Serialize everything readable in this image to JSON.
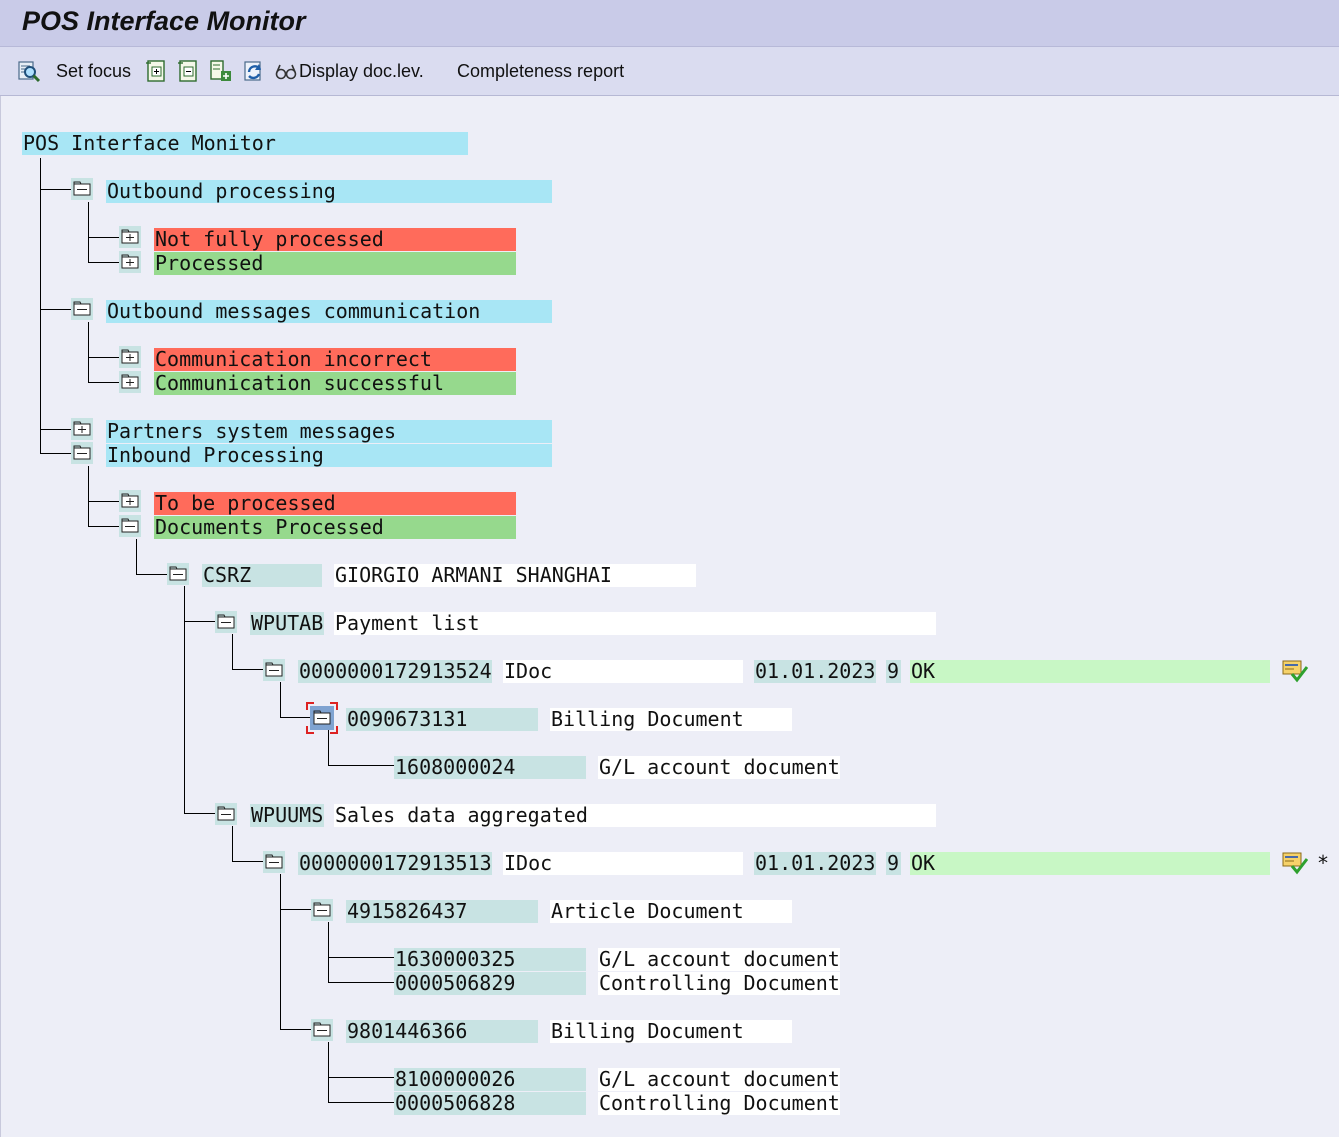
{
  "window": {
    "title": "POS Interface Monitor"
  },
  "toolbar": {
    "set_focus": "Set focus",
    "display_doc_level": "Display doc.lev.",
    "completeness_report": "Completeness report"
  },
  "tree": {
    "root": "POS Interface Monitor",
    "outbound_processing": "Outbound processing",
    "not_fully_processed": "Not fully processed",
    "processed": "Processed",
    "outbound_messages_communication": "Outbound messages communication",
    "communication_incorrect": "Communication incorrect",
    "communication_successful": "Communication successful",
    "partners_system_messages": "Partners system messages",
    "inbound_processing": "Inbound Processing",
    "to_be_processed": "To be processed",
    "documents_processed": "Documents Processed",
    "store": {
      "code": "CSRZ",
      "name": "GIORGIO ARMANI SHANGHAI"
    },
    "wputab": {
      "code": "WPUTAB",
      "desc": "Payment list",
      "idoc": {
        "number": "0000000172913524",
        "type": "IDoc",
        "date": "01.01.2023",
        "status": "9",
        "text": "OK"
      },
      "billing": {
        "number": "0090673131",
        "desc": "Billing Document"
      },
      "gl": {
        "number": "1608000024",
        "desc": "G/L account document"
      }
    },
    "wpuums": {
      "code": "WPUUMS",
      "desc": "Sales data aggregated",
      "idoc": {
        "number": "0000000172913513",
        "type": "IDoc",
        "date": "01.01.2023",
        "status": "9",
        "text": "OK",
        "mark": "*"
      },
      "article": {
        "number": "4915826437",
        "desc": "Article Document"
      },
      "gl1": {
        "number": "1630000325",
        "desc": "G/L account document"
      },
      "co1": {
        "number": "0000506829",
        "desc": "Controlling Document"
      },
      "billing": {
        "number": "9801446366",
        "desc": "Billing Document"
      },
      "gl2": {
        "number": "8100000026",
        "desc": "G/L account document"
      },
      "co2": {
        "number": "0000506828",
        "desc": "Controlling Document"
      }
    }
  },
  "icons": {
    "toolbar": [
      "find-icon",
      "expand-subtree-icon",
      "collapse-subtree-icon",
      "expand-all-icon",
      "refresh-icon",
      "glasses-icon"
    ],
    "tree": [
      "folder-open-icon",
      "folder-closed-icon",
      "idoc-ok-icon"
    ]
  },
  "colors": {
    "node_cyan": "#a8e6f5",
    "status_red": "#ff6b5b",
    "status_green": "#96d98d",
    "ok_green": "#c8f7c5",
    "key_teal": "#c8e3e3"
  }
}
